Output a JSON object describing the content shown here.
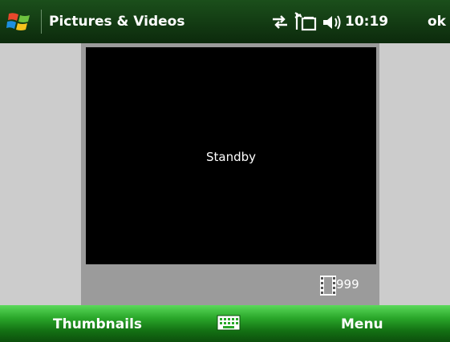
{
  "titlebar": {
    "title": "Pictures & Videos",
    "time": "10:19",
    "ok_label": "ok",
    "icons": [
      "windows-start-icon",
      "sync-icon",
      "antenna-icon",
      "volume-icon"
    ]
  },
  "viewer": {
    "status_text": "Standby",
    "counter": "999",
    "icon": "film-icon"
  },
  "softkeys": {
    "left": "Thumbnails",
    "right": "Menu",
    "center_icon": "keyboard-icon"
  },
  "colors": {
    "titlebar": "#113a11",
    "softkey_bar": "#2aa72a",
    "viewer_screen": "#000000",
    "viewer_frame": "#9b9b9b",
    "background": "#cccccc"
  }
}
